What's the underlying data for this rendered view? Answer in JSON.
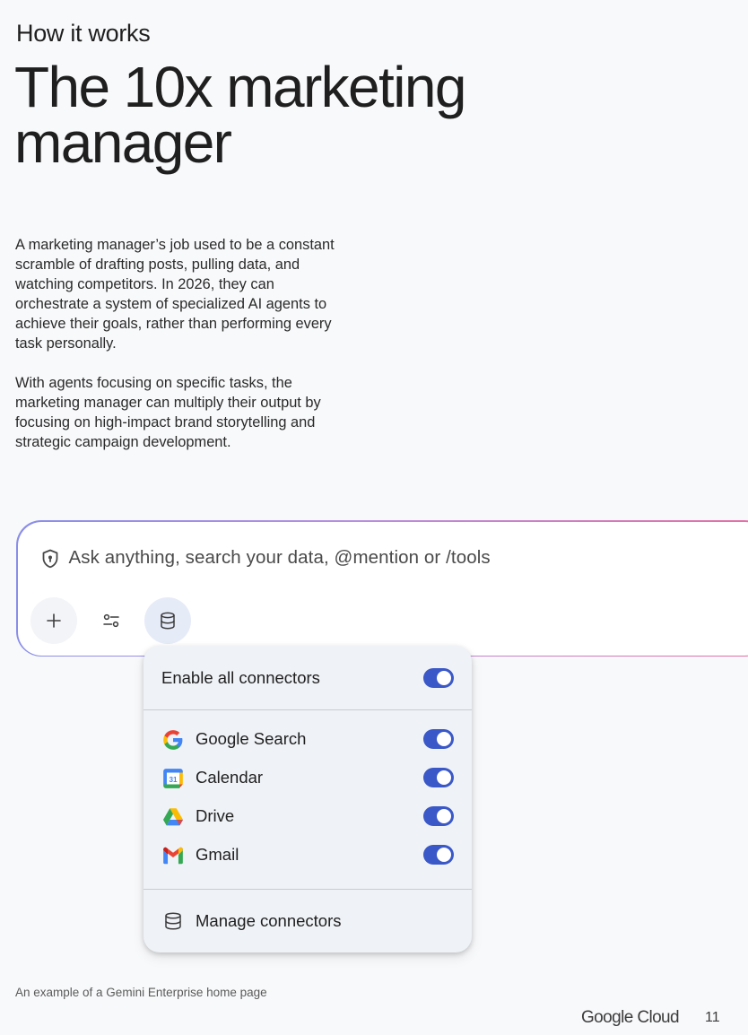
{
  "header": {
    "eyebrow": "How it works",
    "title": "The 10x marketing manager"
  },
  "body": {
    "paragraph_1": "A marketing manager’s job used to be a constant scramble of drafting posts, pulling data, and watching competitors. In 2026, they can orchestrate a system of specialized AI agents to achieve their goals, rather than performing every task personally.",
    "paragraph_2": "With agents focusing on specific tasks, the marketing manager can multiply their output by focusing on high-impact brand storytelling and strategic campaign development."
  },
  "prompt": {
    "placeholder": "Ask anything, search your data, @mention or /tools",
    "buttons": {
      "add_icon": "plus-icon",
      "tools_icon": "tune-icon",
      "connectors_icon": "database-icon"
    }
  },
  "connectors_menu": {
    "enable_all_label": "Enable all connectors",
    "enable_all_on": true,
    "items": [
      {
        "label": "Google Search",
        "icon": "google-g-icon",
        "enabled": true
      },
      {
        "label": "Calendar",
        "icon": "calendar-icon",
        "calendar_day": "31",
        "enabled": true
      },
      {
        "label": "Drive",
        "icon": "drive-icon",
        "enabled": true
      },
      {
        "label": "Gmail",
        "icon": "gmail-icon",
        "enabled": true
      }
    ],
    "manage_label": "Manage connectors"
  },
  "footer": {
    "caption": "An example of a Gemini Enterprise home page",
    "logo_text": "Google Cloud",
    "page_number": "11"
  },
  "colors": {
    "toggle_on": "#3a58c7",
    "prompt_gradient_start": "#8a8ee8",
    "prompt_gradient_end": "#e46fa3"
  }
}
